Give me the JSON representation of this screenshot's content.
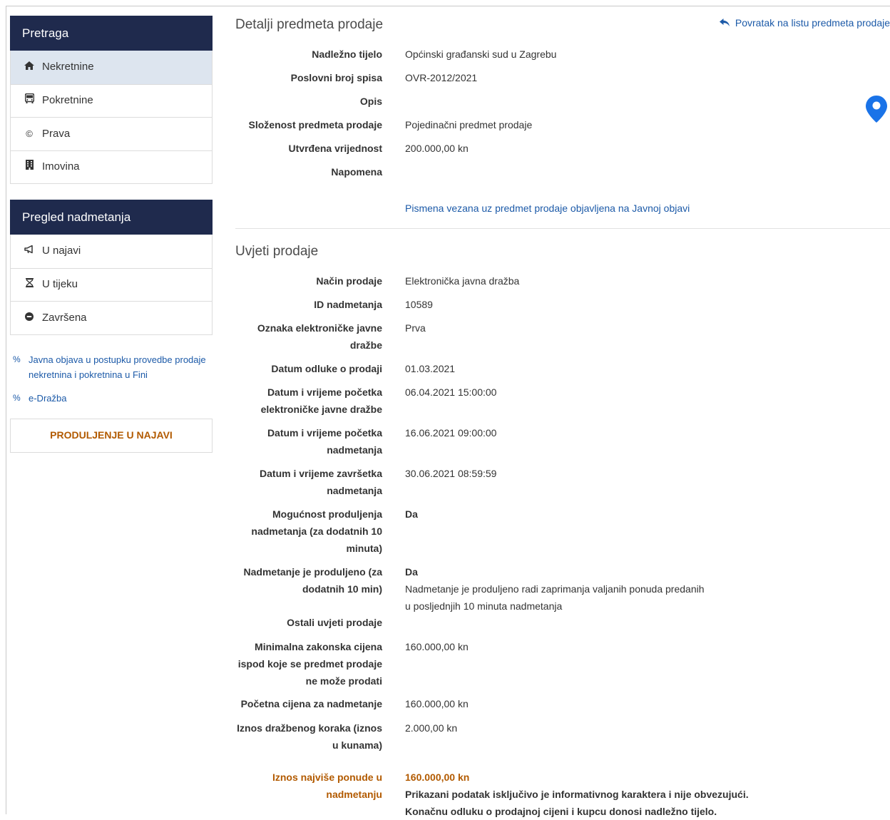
{
  "sidebar": {
    "search_title": "Pretraga",
    "search_items": [
      {
        "label": "Nekretnine",
        "icon": "home-icon"
      },
      {
        "label": "Pokretnine",
        "icon": "bus-icon"
      },
      {
        "label": "Prava",
        "icon": "copyright-icon"
      },
      {
        "label": "Imovina",
        "icon": "building-icon"
      }
    ],
    "review_title": "Pregled nadmetanja",
    "review_items": [
      {
        "label": "U najavi",
        "icon": "megaphone-icon"
      },
      {
        "label": "U tijeku",
        "icon": "hourglass-icon"
      },
      {
        "label": "Završena",
        "icon": "minus-circle-icon"
      }
    ],
    "links": [
      {
        "label": "Javna objava u postupku provedbe prodaje nekretnina i pokretnina u Fini",
        "icon": "link-icon"
      },
      {
        "label": "e-Dražba",
        "icon": "link-icon"
      }
    ],
    "extend_label": "PRODULJENJE U NAJAVI"
  },
  "details": {
    "title": "Detalji predmeta prodaje",
    "back_link": "Povratak na listu predmeta prodaje",
    "rows": [
      {
        "label": "Nadležno tijelo",
        "value": "Općinski građanski sud u Zagrebu"
      },
      {
        "label": "Poslovni broj spisa",
        "value": "OVR-2012/2021"
      },
      {
        "label": "Opis",
        "value": ""
      },
      {
        "label": "Složenost predmeta prodaje",
        "value": "Pojedinačni predmet prodaje"
      },
      {
        "label": "Utvrđena vrijednost",
        "value": "200.000,00 kn"
      },
      {
        "label": "Napomena",
        "value": ""
      }
    ],
    "documents_link": "Pismena vezana uz predmet prodaje objavljena na Javnoj objavi"
  },
  "conditions": {
    "title": "Uvjeti prodaje",
    "rows": [
      {
        "label": "Način prodaje",
        "value": "Elektronička javna dražba"
      },
      {
        "label": "ID nadmetanja",
        "value": "10589"
      },
      {
        "label": "Oznaka elektroničke javne dražbe",
        "value": "Prva"
      },
      {
        "label": "Datum odluke o prodaji",
        "value": "01.03.2021"
      },
      {
        "label": "Datum i vrijeme početka elektroničke javne dražbe",
        "value": "06.04.2021 15:00:00"
      },
      {
        "label": "Datum i vrijeme početka nadmetanja",
        "value": "16.06.2021 09:00:00"
      },
      {
        "label": "Datum i vrijeme završetka nadmetanja",
        "value": "30.06.2021 08:59:59"
      },
      {
        "label": "Mogućnost produljenja nadmetanja (za dodatnih 10 minuta)",
        "value": "Da"
      },
      {
        "label": "Nadmetanje je produljeno (za dodatnih 10 min)",
        "value": "Da",
        "note": "Nadmetanje je produljeno radi zaprimanja valjanih ponuda predanih u posljednjih 10 minuta nadmetanja"
      },
      {
        "label": "Ostali uvjeti prodaje",
        "value": ""
      },
      {
        "label": "Minimalna zakonska cijena ispod koje se predmet prodaje ne može prodati",
        "value": "160.000,00 kn"
      },
      {
        "label": "Početna cijena za nadmetanje",
        "value": "160.000,00 kn"
      },
      {
        "label": "Iznos dražbenog koraka (iznos u kunama)",
        "value": "2.000,00 kn"
      },
      {
        "label": "Iznos najviše ponude u nadmetanju",
        "value": "160.000,00 kn",
        "note": "Prikazani podatak isključivo je informativnog karaktera i nije obvezujući. Konačnu odluku o prodajnoj cijeni i kupcu donosi nadležno tijelo."
      }
    ]
  },
  "colors": {
    "navy": "#1f2a4d",
    "link": "#1c5aa8",
    "accent": "#b25a00",
    "pin": "#1a73e8"
  }
}
